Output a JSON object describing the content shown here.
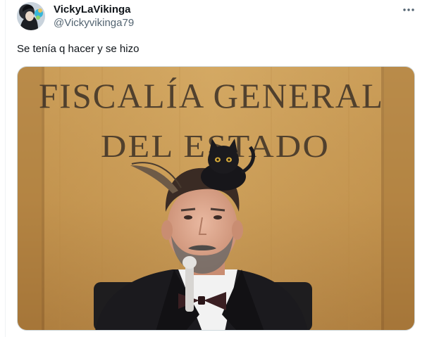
{
  "tweet": {
    "author": {
      "display_name": "VickyLaVikinga",
      "handle": "@Vickyvikinga79"
    },
    "text": "Se tenía q hacer y se hizo",
    "media": {
      "sign_line_1": "FISCALÍA GENERAL",
      "sign_line_2": "DEL ESTADO"
    }
  },
  "icons": {
    "more": "more-horizontal-icon",
    "avatar": "avatar-image"
  },
  "colors": {
    "text_primary": "#0f1419",
    "text_secondary": "#536471",
    "border": "#cfd9de"
  }
}
